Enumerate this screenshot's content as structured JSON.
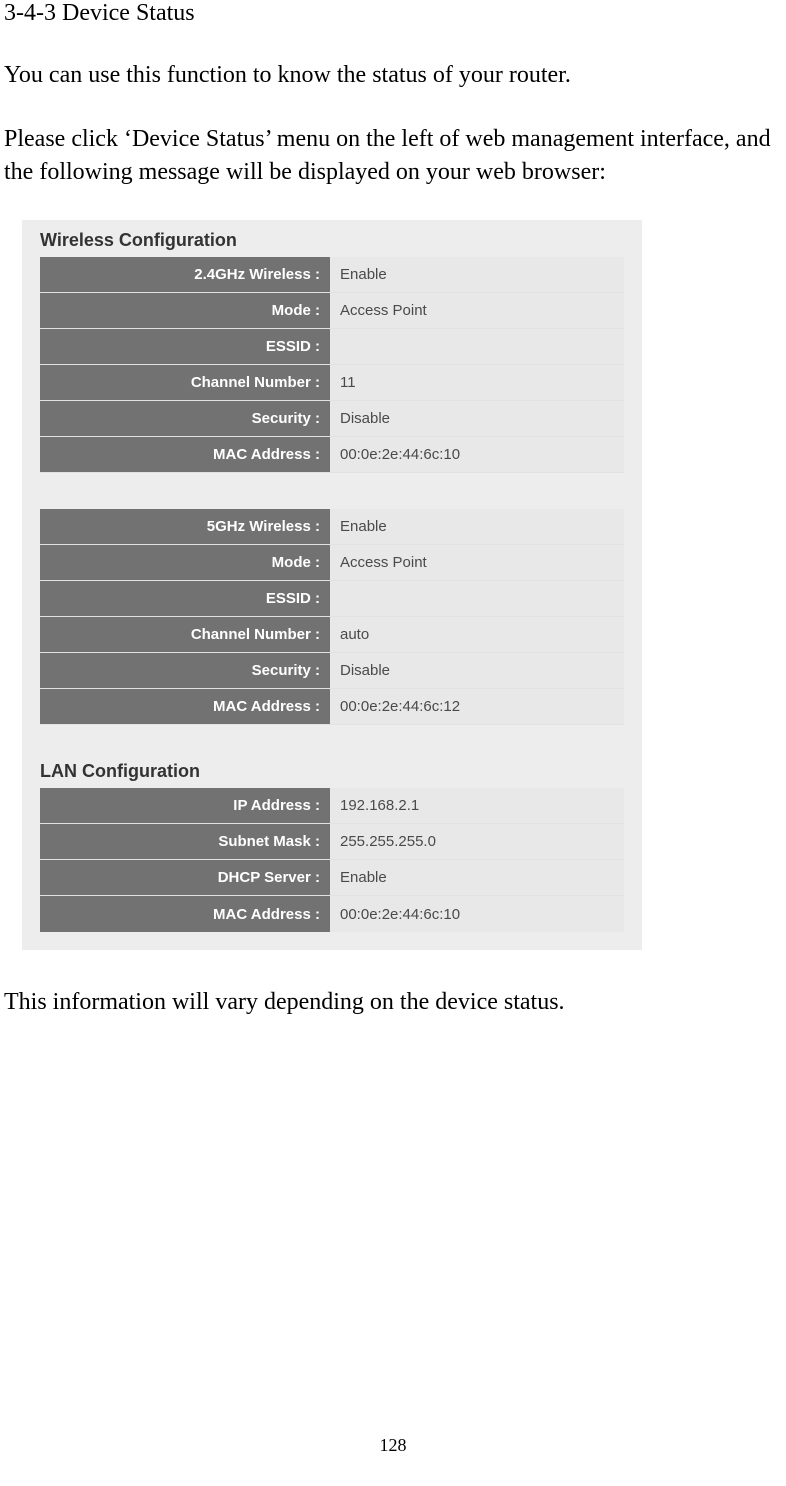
{
  "section_title": "3-4-3 Device Status",
  "para1": "You can use this function to know the status of your router.",
  "para2": "Please click ‘Device Status’ menu on the left of web management interface, and the following message will be displayed on your web browser:",
  "para3": "This information will vary depending on the device status.",
  "page_number": "128",
  "wireless_config_title": "Wireless Configuration",
  "lan_config_title": "LAN Configuration",
  "wifi24": {
    "wireless_label": "2.4GHz Wireless :",
    "wireless_value": "Enable",
    "mode_label": "Mode :",
    "mode_value": "Access Point",
    "essid_label": "ESSID :",
    "essid_value": "",
    "channel_label": "Channel Number :",
    "channel_value": "11",
    "security_label": "Security :",
    "security_value": "Disable",
    "mac_label": "MAC Address :",
    "mac_value": "00:0e:2e:44:6c:10"
  },
  "wifi5": {
    "wireless_label": "5GHz Wireless :",
    "wireless_value": "Enable",
    "mode_label": "Mode :",
    "mode_value": "Access Point",
    "essid_label": "ESSID :",
    "essid_value": "",
    "channel_label": "Channel Number :",
    "channel_value": "auto",
    "security_label": "Security :",
    "security_value": "Disable",
    "mac_label": "MAC Address :",
    "mac_value": "00:0e:2e:44:6c:12"
  },
  "lan": {
    "ip_label": "IP Address :",
    "ip_value": "192.168.2.1",
    "subnet_label": "Subnet Mask :",
    "subnet_value": "255.255.255.0",
    "dhcp_label": "DHCP Server :",
    "dhcp_value": "Enable",
    "mac_label": "MAC Address :",
    "mac_value": "00:0e:2e:44:6c:10"
  }
}
